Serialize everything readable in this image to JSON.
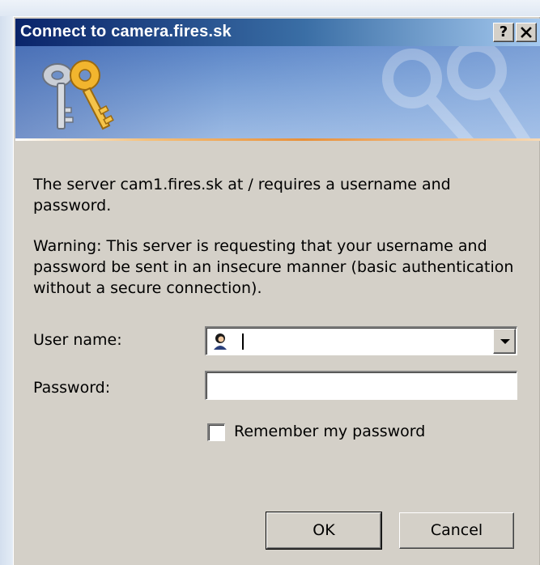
{
  "window": {
    "title": "Connect to camera.fires.sk",
    "help_button": "?",
    "close_button": "✕"
  },
  "banner": {
    "icon": "keys-icon"
  },
  "message": {
    "line1": "The server cam1.fires.sk at / requires a username and password.",
    "warning": "Warning: This server is requesting that your username and password be sent in an insecure manner (basic authentication without a secure connection)."
  },
  "form": {
    "username_label": "User name:",
    "username_value": "",
    "username_icon": "user-icon",
    "password_label": "Password:",
    "password_value": "",
    "remember_label": "Remember my password",
    "remember_checked": false
  },
  "buttons": {
    "ok_label": "OK",
    "cancel_label": "Cancel"
  },
  "colors": {
    "titlebar_start": "#0a246a",
    "titlebar_end": "#a6caf0",
    "dialog_face": "#d4d0c8",
    "accent_line": "#e8903a"
  }
}
